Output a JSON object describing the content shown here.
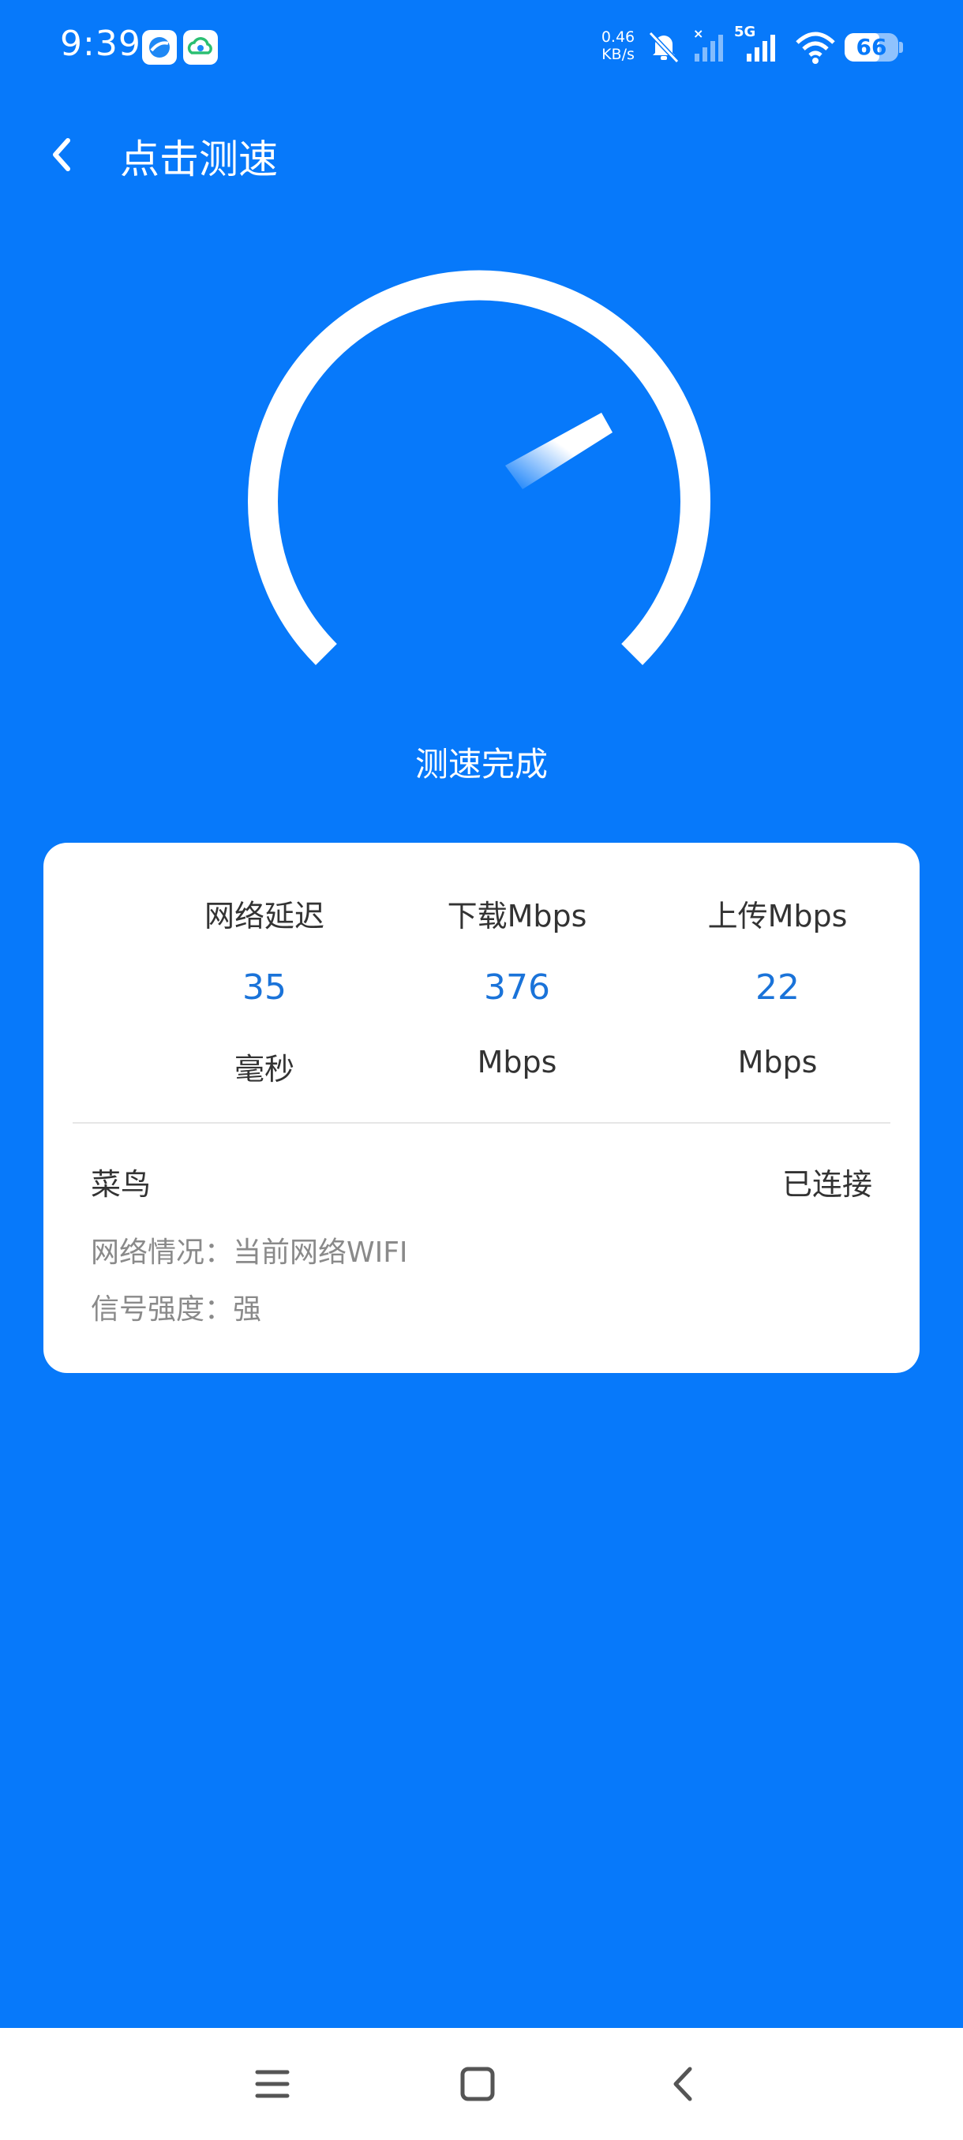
{
  "status_bar": {
    "time": "9:39",
    "net_speed_value": "0.46",
    "net_speed_unit": "KB/s",
    "network_type": "5G",
    "battery": "66",
    "icons": [
      "browser-app-icon",
      "cloud-app-icon",
      "mute-icon",
      "signal-sim1-icon",
      "signal-sim2-icon",
      "wifi-icon",
      "battery-icon"
    ]
  },
  "header": {
    "title": "点击测速",
    "back_icon": "chevron-left-icon"
  },
  "gauge": {
    "status": "测速完成"
  },
  "results": {
    "metrics": [
      {
        "label": "网络延迟",
        "value": "35",
        "unit": "毫秒"
      },
      {
        "label": "下载Mbps",
        "value": "376",
        "unit": "Mbps"
      },
      {
        "label": "上传Mbps",
        "value": "22",
        "unit": "Mbps"
      }
    ],
    "network": {
      "name": "菜鸟",
      "status": "已连接",
      "condition": "网络情况：当前网络WIFI",
      "signal": "信号强度：强"
    },
    "value_color": "#1a73d9"
  },
  "nav_bar": {
    "icons": [
      "menu-icon",
      "home-icon",
      "back-icon"
    ]
  },
  "colors": {
    "background": "#0779fa",
    "card": "#ffffff"
  }
}
